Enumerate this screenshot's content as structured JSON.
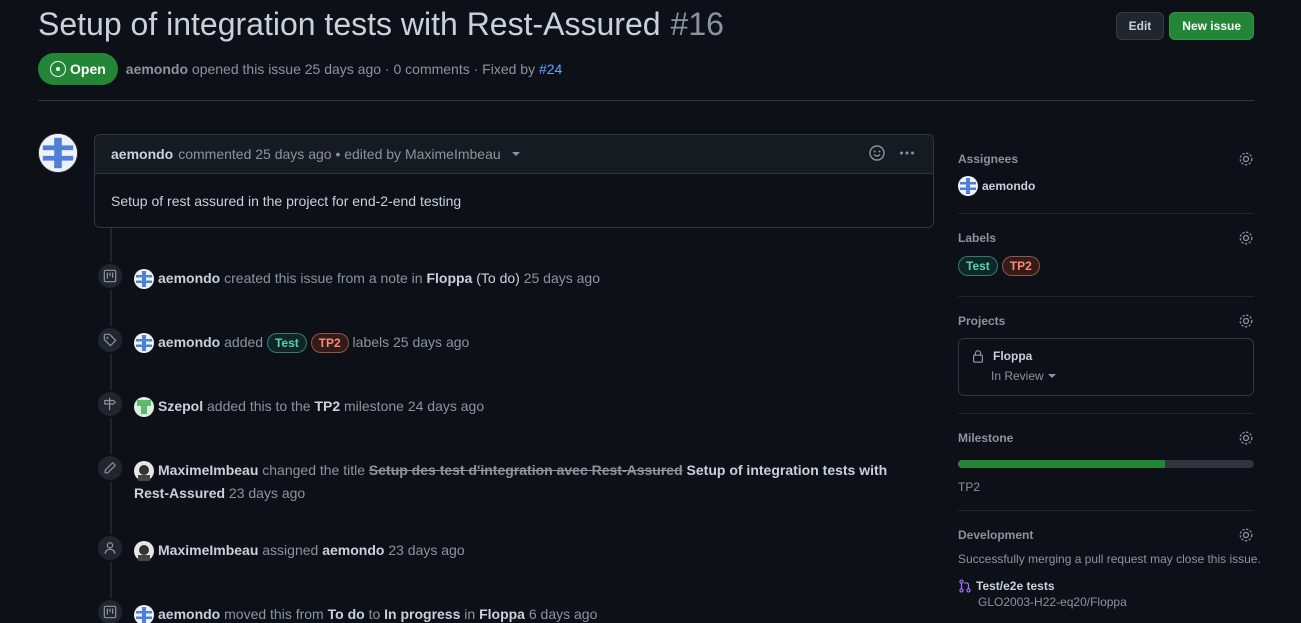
{
  "issue": {
    "title": "Setup of integration tests with Rest-Assured",
    "number": "#16",
    "state": "Open",
    "author": "aemondo",
    "opened_text": "opened this issue 25 days ago · 0 comments · Fixed by",
    "fixed_by": "#24"
  },
  "header": {
    "edit_label": "Edit",
    "new_issue_label": "New issue"
  },
  "comment": {
    "author": "aemondo",
    "meta": "commented 25 days ago • edited by MaximeImbeau",
    "body": "Setup of rest assured in the project for end-2-end testing"
  },
  "timeline": [
    {
      "actor": "aemondo",
      "text1": "created this issue from a note in",
      "project": "Floppa",
      "column": "(To do)",
      "time": "25 days ago"
    },
    {
      "actor": "aemondo",
      "text1": "added",
      "label1": "Test",
      "label2": "TP2",
      "text2": "labels 25 days ago"
    },
    {
      "actor": "Szepol",
      "text1": "added this to the",
      "milestone": "TP2",
      "text2": "milestone 24 days ago"
    },
    {
      "actor": "MaximeImbeau",
      "text1": "changed the title",
      "old_title": "Setup des test d'integration avec Rest-Assured",
      "new_title": "Setup of integration tests with Rest-Assured",
      "time": "23 days ago"
    },
    {
      "actor": "MaximeImbeau",
      "text1": "assigned",
      "assignee": "aemondo",
      "time": "23 days ago"
    },
    {
      "actor": "aemondo",
      "text1": "moved this from",
      "from": "To do",
      "to_word": "to",
      "to": "In progress",
      "in_word": "in",
      "project": "Floppa",
      "time": "6 days ago"
    }
  ],
  "sidebar": {
    "assignees_title": "Assignees",
    "assignee": "aemondo",
    "labels_title": "Labels",
    "labels": [
      "Test",
      "TP2"
    ],
    "projects_title": "Projects",
    "project_name": "Floppa",
    "project_status": "In Review",
    "milestone_title": "Milestone",
    "milestone_progress": 0.7,
    "milestone_name": "TP2",
    "development_title": "Development",
    "development_note": "Successfully merging a pull request may close this issue.",
    "branch_name": "Test/e2e tests",
    "branch_repo": "GLO2003-H22-eq20/Floppa"
  },
  "colors": {
    "background": "#0d1117",
    "open_green": "#238636",
    "label_test": "#55d4b0",
    "label_tp2": "#ff8a6e",
    "link": "#58a6ff"
  }
}
